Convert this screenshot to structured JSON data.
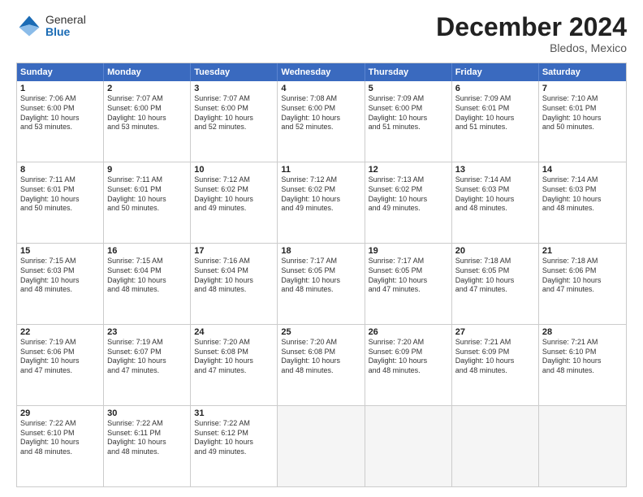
{
  "logo": {
    "general": "General",
    "blue": "Blue"
  },
  "title": "December 2024",
  "location": "Bledos, Mexico",
  "header_days": [
    "Sunday",
    "Monday",
    "Tuesday",
    "Wednesday",
    "Thursday",
    "Friday",
    "Saturday"
  ],
  "weeks": [
    [
      {
        "day": "1",
        "rise": "Sunrise: 7:06 AM",
        "set": "Sunset: 6:00 PM",
        "daylight": "Daylight: 10 hours",
        "daylight2": "and 53 minutes."
      },
      {
        "day": "2",
        "rise": "Sunrise: 7:07 AM",
        "set": "Sunset: 6:00 PM",
        "daylight": "Daylight: 10 hours",
        "daylight2": "and 53 minutes."
      },
      {
        "day": "3",
        "rise": "Sunrise: 7:07 AM",
        "set": "Sunset: 6:00 PM",
        "daylight": "Daylight: 10 hours",
        "daylight2": "and 52 minutes."
      },
      {
        "day": "4",
        "rise": "Sunrise: 7:08 AM",
        "set": "Sunset: 6:00 PM",
        "daylight": "Daylight: 10 hours",
        "daylight2": "and 52 minutes."
      },
      {
        "day": "5",
        "rise": "Sunrise: 7:09 AM",
        "set": "Sunset: 6:00 PM",
        "daylight": "Daylight: 10 hours",
        "daylight2": "and 51 minutes."
      },
      {
        "day": "6",
        "rise": "Sunrise: 7:09 AM",
        "set": "Sunset: 6:01 PM",
        "daylight": "Daylight: 10 hours",
        "daylight2": "and 51 minutes."
      },
      {
        "day": "7",
        "rise": "Sunrise: 7:10 AM",
        "set": "Sunset: 6:01 PM",
        "daylight": "Daylight: 10 hours",
        "daylight2": "and 50 minutes."
      }
    ],
    [
      {
        "day": "8",
        "rise": "Sunrise: 7:11 AM",
        "set": "Sunset: 6:01 PM",
        "daylight": "Daylight: 10 hours",
        "daylight2": "and 50 minutes."
      },
      {
        "day": "9",
        "rise": "Sunrise: 7:11 AM",
        "set": "Sunset: 6:01 PM",
        "daylight": "Daylight: 10 hours",
        "daylight2": "and 50 minutes."
      },
      {
        "day": "10",
        "rise": "Sunrise: 7:12 AM",
        "set": "Sunset: 6:02 PM",
        "daylight": "Daylight: 10 hours",
        "daylight2": "and 49 minutes."
      },
      {
        "day": "11",
        "rise": "Sunrise: 7:12 AM",
        "set": "Sunset: 6:02 PM",
        "daylight": "Daylight: 10 hours",
        "daylight2": "and 49 minutes."
      },
      {
        "day": "12",
        "rise": "Sunrise: 7:13 AM",
        "set": "Sunset: 6:02 PM",
        "daylight": "Daylight: 10 hours",
        "daylight2": "and 49 minutes."
      },
      {
        "day": "13",
        "rise": "Sunrise: 7:14 AM",
        "set": "Sunset: 6:03 PM",
        "daylight": "Daylight: 10 hours",
        "daylight2": "and 48 minutes."
      },
      {
        "day": "14",
        "rise": "Sunrise: 7:14 AM",
        "set": "Sunset: 6:03 PM",
        "daylight": "Daylight: 10 hours",
        "daylight2": "and 48 minutes."
      }
    ],
    [
      {
        "day": "15",
        "rise": "Sunrise: 7:15 AM",
        "set": "Sunset: 6:03 PM",
        "daylight": "Daylight: 10 hours",
        "daylight2": "and 48 minutes."
      },
      {
        "day": "16",
        "rise": "Sunrise: 7:15 AM",
        "set": "Sunset: 6:04 PM",
        "daylight": "Daylight: 10 hours",
        "daylight2": "and 48 minutes."
      },
      {
        "day": "17",
        "rise": "Sunrise: 7:16 AM",
        "set": "Sunset: 6:04 PM",
        "daylight": "Daylight: 10 hours",
        "daylight2": "and 48 minutes."
      },
      {
        "day": "18",
        "rise": "Sunrise: 7:17 AM",
        "set": "Sunset: 6:05 PM",
        "daylight": "Daylight: 10 hours",
        "daylight2": "and 48 minutes."
      },
      {
        "day": "19",
        "rise": "Sunrise: 7:17 AM",
        "set": "Sunset: 6:05 PM",
        "daylight": "Daylight: 10 hours",
        "daylight2": "and 47 minutes."
      },
      {
        "day": "20",
        "rise": "Sunrise: 7:18 AM",
        "set": "Sunset: 6:05 PM",
        "daylight": "Daylight: 10 hours",
        "daylight2": "and 47 minutes."
      },
      {
        "day": "21",
        "rise": "Sunrise: 7:18 AM",
        "set": "Sunset: 6:06 PM",
        "daylight": "Daylight: 10 hours",
        "daylight2": "and 47 minutes."
      }
    ],
    [
      {
        "day": "22",
        "rise": "Sunrise: 7:19 AM",
        "set": "Sunset: 6:06 PM",
        "daylight": "Daylight: 10 hours",
        "daylight2": "and 47 minutes."
      },
      {
        "day": "23",
        "rise": "Sunrise: 7:19 AM",
        "set": "Sunset: 6:07 PM",
        "daylight": "Daylight: 10 hours",
        "daylight2": "and 47 minutes."
      },
      {
        "day": "24",
        "rise": "Sunrise: 7:20 AM",
        "set": "Sunset: 6:08 PM",
        "daylight": "Daylight: 10 hours",
        "daylight2": "and 47 minutes."
      },
      {
        "day": "25",
        "rise": "Sunrise: 7:20 AM",
        "set": "Sunset: 6:08 PM",
        "daylight": "Daylight: 10 hours",
        "daylight2": "and 48 minutes."
      },
      {
        "day": "26",
        "rise": "Sunrise: 7:20 AM",
        "set": "Sunset: 6:09 PM",
        "daylight": "Daylight: 10 hours",
        "daylight2": "and 48 minutes."
      },
      {
        "day": "27",
        "rise": "Sunrise: 7:21 AM",
        "set": "Sunset: 6:09 PM",
        "daylight": "Daylight: 10 hours",
        "daylight2": "and 48 minutes."
      },
      {
        "day": "28",
        "rise": "Sunrise: 7:21 AM",
        "set": "Sunset: 6:10 PM",
        "daylight": "Daylight: 10 hours",
        "daylight2": "and 48 minutes."
      }
    ],
    [
      {
        "day": "29",
        "rise": "Sunrise: 7:22 AM",
        "set": "Sunset: 6:10 PM",
        "daylight": "Daylight: 10 hours",
        "daylight2": "and 48 minutes."
      },
      {
        "day": "30",
        "rise": "Sunrise: 7:22 AM",
        "set": "Sunset: 6:11 PM",
        "daylight": "Daylight: 10 hours",
        "daylight2": "and 48 minutes."
      },
      {
        "day": "31",
        "rise": "Sunrise: 7:22 AM",
        "set": "Sunset: 6:12 PM",
        "daylight": "Daylight: 10 hours",
        "daylight2": "and 49 minutes."
      },
      null,
      null,
      null,
      null
    ]
  ]
}
